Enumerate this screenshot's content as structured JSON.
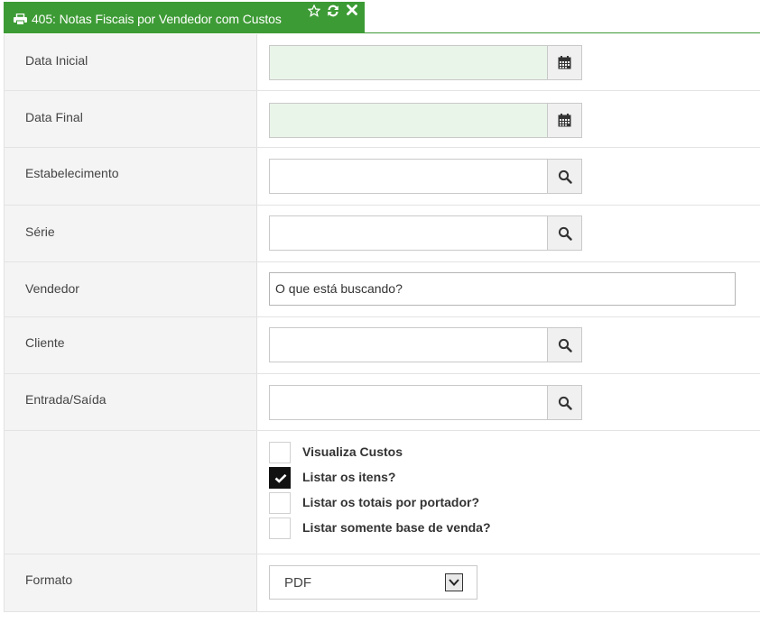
{
  "tab": {
    "title": "405: Notas Fiscais por Vendedor com Custos",
    "accent_color": "#3d9b35",
    "icons": [
      "printer-icon",
      "star-icon",
      "refresh-icon",
      "close-icon"
    ]
  },
  "fields": {
    "data_inicial": {
      "label": "Data Inicial",
      "value": "",
      "icon": "calendar-icon"
    },
    "data_final": {
      "label": "Data Final",
      "value": "",
      "icon": "calendar-icon"
    },
    "estabelecimento": {
      "label": "Estabelecimento",
      "value": "",
      "icon": "search-icon"
    },
    "serie": {
      "label": "Série",
      "value": "",
      "icon": "search-icon"
    },
    "vendedor": {
      "label": "Vendedor",
      "placeholder": "O que está buscando?"
    },
    "cliente": {
      "label": "Cliente",
      "value": "",
      "icon": "search-icon"
    },
    "entrada_saida": {
      "label": "Entrada/Saída",
      "value": "",
      "icon": "search-icon"
    }
  },
  "options": [
    {
      "label": "Visualiza Custos",
      "checked": false
    },
    {
      "label": "Listar os itens?",
      "checked": true
    },
    {
      "label": "Listar os totais por portador?",
      "checked": false
    },
    {
      "label": "Listar somente base de venda?",
      "checked": false
    }
  ],
  "formato": {
    "label": "Formato",
    "selected": "PDF"
  }
}
